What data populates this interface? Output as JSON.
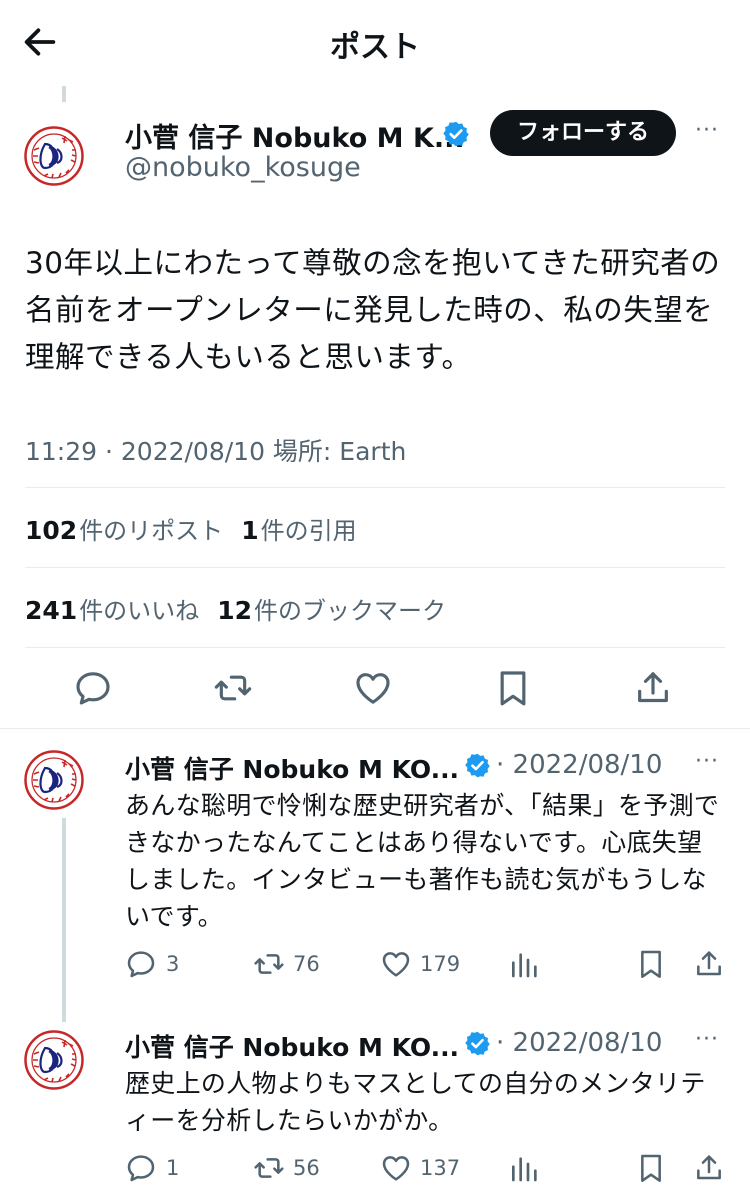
{
  "header": {
    "title": "ポスト"
  },
  "main_post": {
    "author_name": "小菅 信子 Nobuko M K...",
    "handle": "@nobuko_kosuge",
    "follow_label": "フォローする",
    "more": "···",
    "text": "30年以上にわたって尊敬の念を抱いてきた研究者の名前をオープンレターに発見した時の、私の失望を理解できる人もいると思います。",
    "meta": "11:29 · 2022/08/10 場所: Earth",
    "stats": {
      "reposts_count": "102",
      "reposts_label": "件のリポスト",
      "quotes_count": "1",
      "quotes_label": "件の引用",
      "likes_count": "241",
      "likes_label": "件のいいね",
      "bookmarks_count": "12",
      "bookmarks_label": "件のブックマーク"
    }
  },
  "replies": [
    {
      "author_name": "小菅 信子 Nobuko M KO...",
      "date": "· 2022/08/10",
      "more": "···",
      "text": "あんな聡明で怜悧な歴史研究者が、「結果」を予測できなかったなんてことはあり得ないです。心底失望しました。インタビューも著作も読む気がもうしないです。",
      "reply_count": "3",
      "repost_count": "76",
      "like_count": "179"
    },
    {
      "author_name": "小菅 信子 Nobuko M KO...",
      "date": "· 2022/08/10",
      "more": "···",
      "text": "歴史上の人物よりもマスとしての自分のメンタリティーを分析したらいかがか。",
      "reply_count": "1",
      "repost_count": "56",
      "like_count": "137"
    }
  ],
  "icons": {
    "back": "arrow-left-icon",
    "verified": "verified-badge-icon",
    "reply": "speech-bubble-icon",
    "repost": "repost-arrows-icon",
    "like": "heart-icon",
    "bookmark": "bookmark-icon",
    "share": "share-upload-icon",
    "views": "bar-chart-icon"
  },
  "colors": {
    "text": "#0f1419",
    "secondary": "#536471",
    "verified": "#1d9bf0",
    "follow_bg": "#0f1419",
    "divider": "#e6ecf0"
  }
}
